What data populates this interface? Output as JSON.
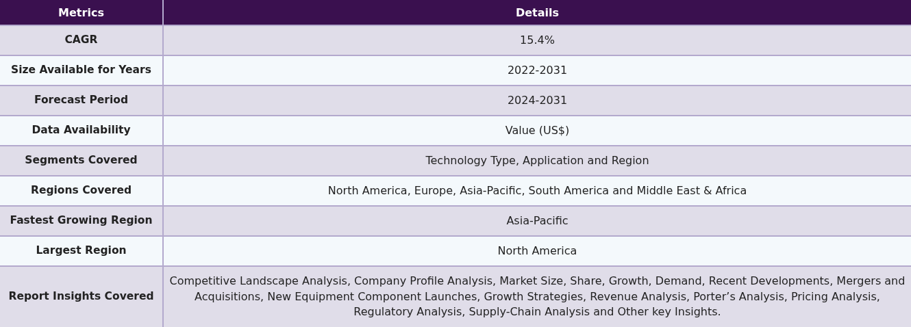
{
  "table": {
    "columns": [
      "Metrics",
      "Details"
    ],
    "rows": [
      {
        "metric": "CAGR",
        "details": "15.4%"
      },
      {
        "metric": "Size Available for Years",
        "details": "2022-2031"
      },
      {
        "metric": "Forecast Period",
        "details": "2024-2031"
      },
      {
        "metric": "Data Availability",
        "details": "Value (US$)"
      },
      {
        "metric": "Segments Covered",
        "details": "Technology Type, Application and Region"
      },
      {
        "metric": "Regions Covered",
        "details": "North America, Europe, Asia-Pacific, South America and Middle East & Africa"
      },
      {
        "metric": "Fastest Growing Region",
        "details": "Asia-Pacific"
      },
      {
        "metric": "Largest Region",
        "details": "North America"
      },
      {
        "metric": "Report Insights Covered",
        "details": "Competitive Landscape Analysis, Company Profile Analysis, Market Size, Share, Growth, Demand, Recent Developments, Mergers and Acquisitions, New Equipment Component Launches, Growth Strategies, Revenue Analysis, Porter’s Analysis, Pricing Analysis, Regulatory Analysis, Supply-Chain Analysis and Other key Insights."
      }
    ]
  }
}
